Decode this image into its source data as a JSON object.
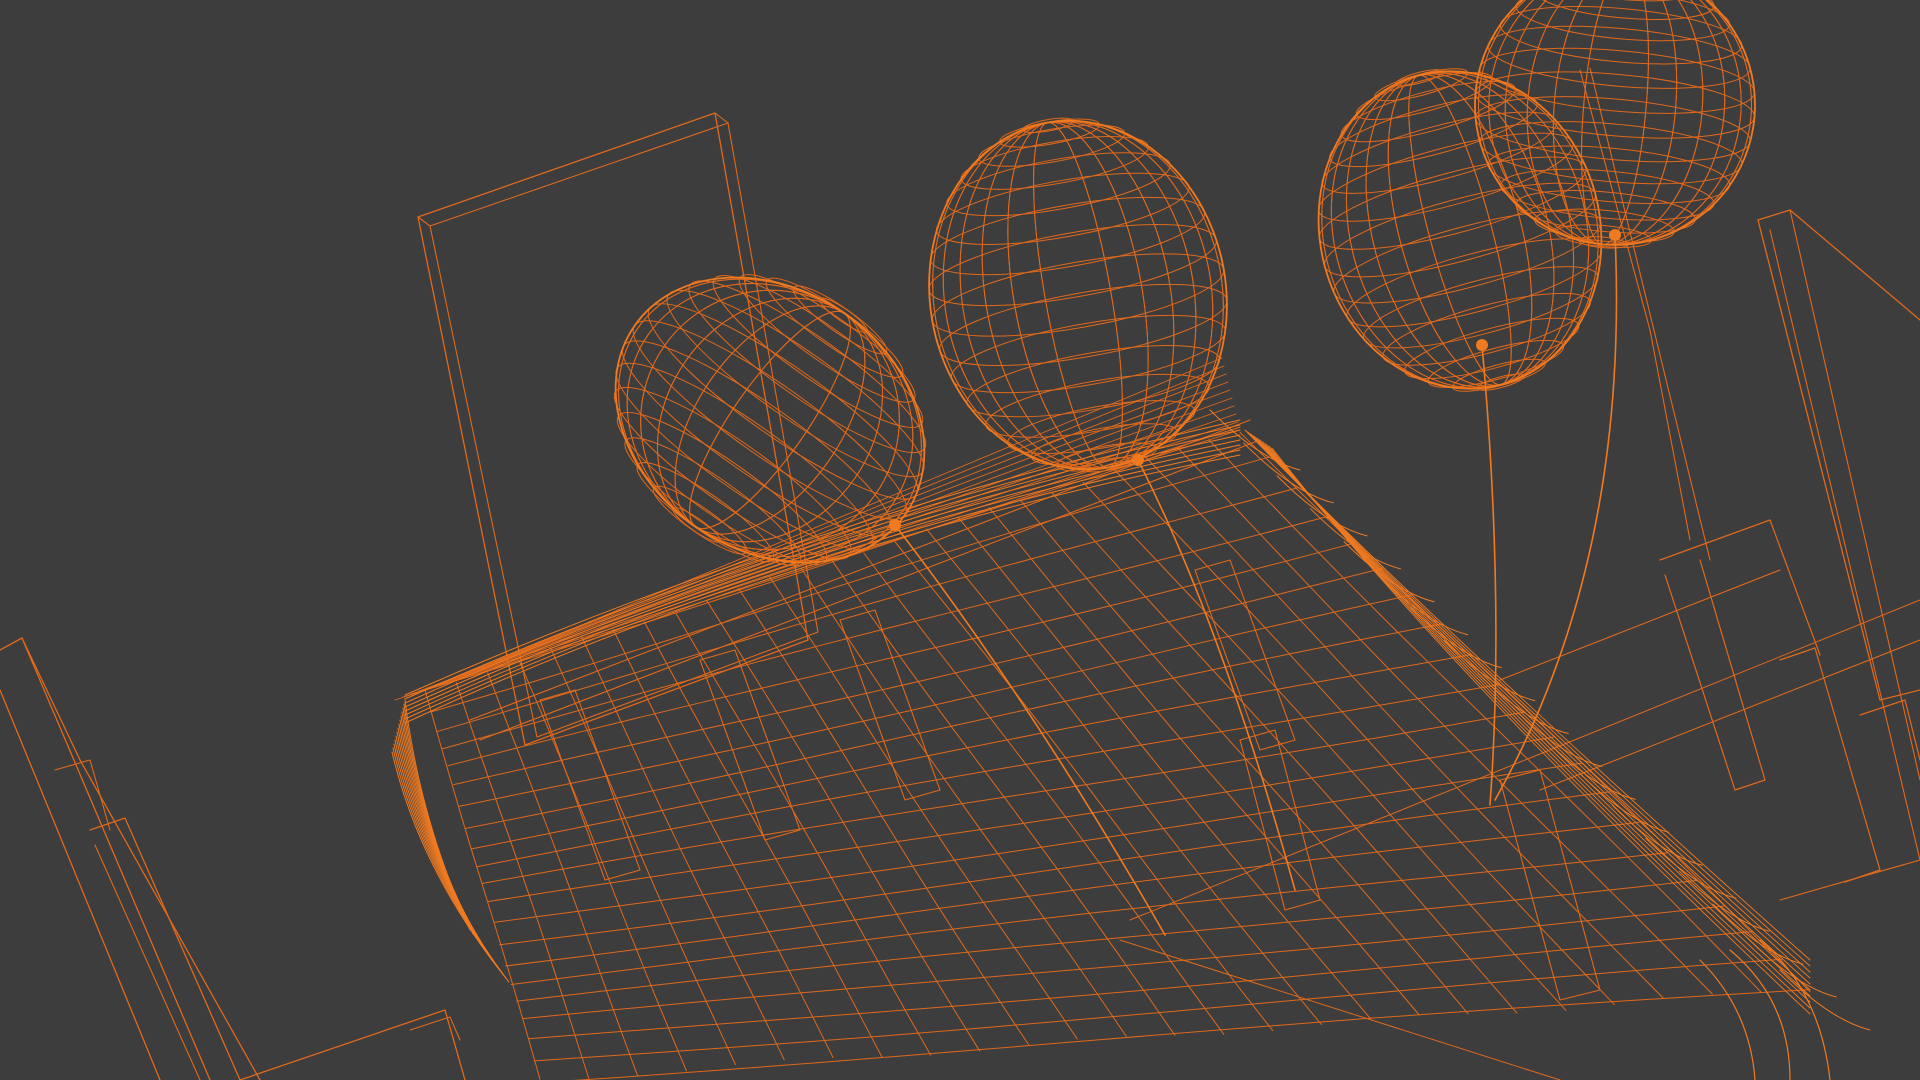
{
  "viewport": {
    "background_color": "#3d3d3d",
    "wire_color": "#e0691c",
    "wire_color_dense": "#f07a20",
    "shading_mode": "wireframe",
    "objects": [
      {
        "name": "table-with-cloth"
      },
      {
        "name": "chair"
      },
      {
        "name": "balloon"
      }
    ]
  }
}
